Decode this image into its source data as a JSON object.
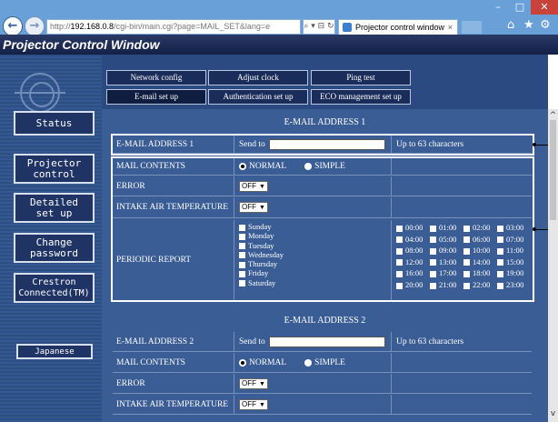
{
  "browser": {
    "window_buttons": [
      "–",
      "□",
      "✕"
    ],
    "back_icon": "←",
    "forward_icon": "→",
    "address_prefix": "http://",
    "address_host": "192.168.0.8",
    "address_path": "/cgi-bin/main.cgi?page=MAIL_SET&lang=e",
    "address_tools": "⌕ ▾ ⊟ ↻",
    "tab_title": "Projector control window",
    "tab_close": "×",
    "toolbar_icons": [
      "⌂",
      "★",
      "⚙"
    ]
  },
  "page_title": "Projector Control Window",
  "sidebar": {
    "items": [
      {
        "label": "Status"
      },
      {
        "label": "Projector\ncontrol"
      },
      {
        "label": "Detailed\nset up"
      },
      {
        "label": "Change\npassword"
      },
      {
        "label": "Crestron\nConnected(TM)"
      }
    ],
    "language_button": "Japanese"
  },
  "top_tabs": {
    "row1": [
      "Network config",
      "Adjust clock",
      "Ping test"
    ],
    "row2": [
      "E-mail set up",
      "Authentication set up",
      "ECO management set up"
    ]
  },
  "email1": {
    "section_title": "E-MAIL ADDRESS 1",
    "address_label": "E-MAIL ADDRESS 1",
    "send_to_label": "Send to",
    "send_to_value": "",
    "limit_note": "Up to 63 characters",
    "mail_contents_label": "MAIL CONTENTS",
    "mail_contents_options": [
      "NORMAL",
      "SIMPLE"
    ],
    "mail_contents_selected": "NORMAL",
    "error_label": "ERROR",
    "error_value": "OFF",
    "intake_label": "INTAKE AIR TEMPERATURE",
    "intake_value": "OFF",
    "periodic_label": "PERIODIC REPORT",
    "days": [
      "Sunday",
      "Monday",
      "Tuesday",
      "Wednesday",
      "Thursday",
      "Friday",
      "Saturday"
    ],
    "hours": [
      "00:00",
      "01:00",
      "02:00",
      "03:00",
      "04:00",
      "05:00",
      "06:00",
      "07:00",
      "08:00",
      "09:00",
      "10:00",
      "11:00",
      "12:00",
      "13:00",
      "14:00",
      "15:00",
      "16:00",
      "17:00",
      "18:00",
      "19:00",
      "20:00",
      "21:00",
      "22:00",
      "23:00"
    ]
  },
  "email2": {
    "section_title": "E-MAIL ADDRESS 2",
    "address_label": "E-MAIL ADDRESS 2",
    "send_to_label": "Send to",
    "send_to_value": "",
    "limit_note": "Up to 63 characters",
    "mail_contents_label": "MAIL CONTENTS",
    "mail_contents_options": [
      "NORMAL",
      "SIMPLE"
    ],
    "mail_contents_selected": "NORMAL",
    "error_label": "ERROR",
    "error_value": "OFF",
    "intake_label": "INTAKE AIR TEMPERATURE",
    "intake_value": "OFF"
  },
  "scrollbar": {
    "up_icon": "^",
    "down_icon": "v"
  },
  "colors": {
    "page_bg": "#3a5d95",
    "sidebar_bg": "#2d4e82",
    "title_bar": "#1c2a55",
    "button_bg": "#1a2d5a"
  }
}
